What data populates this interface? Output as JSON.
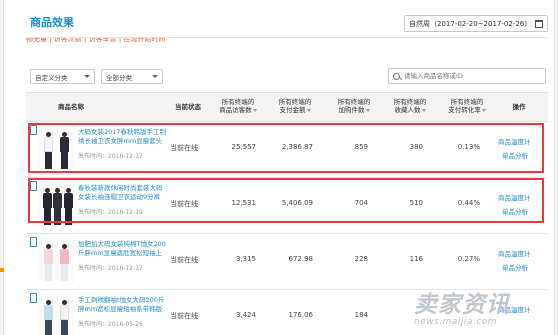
{
  "page": {
    "title": "商品效果"
  },
  "date_picker": {
    "label": "自然周（2017-02-20~2017-02-26）"
  },
  "tabs_partial": "畅无量 | 访客次数 | 访客率暂 | 挂现开始时间",
  "filters": {
    "custom_category": "自定义分类",
    "all_category": "全部分类"
  },
  "search": {
    "placeholder": "请输入商品名称或ID"
  },
  "table": {
    "headers": {
      "name": "商品名称",
      "status": "当前状态",
      "visitors": [
        "所有终端的",
        "商品访客数"
      ],
      "pay_amount": [
        "所有终端的",
        "支付金额"
      ],
      "cart_qty": [
        "所有终端的",
        "加购件数"
      ],
      "fav_count": [
        "所有终端的",
        "收藏人数"
      ],
      "conv_rate": [
        "所有终端的",
        "支付转化率"
      ],
      "action": "操作"
    },
    "rows": [
      {
        "name": "大码女装2017春秋韩版手工制绣长袖卫衣女胖mm显瘦套头打",
        "publish_time": "发布时间：2016-12-17",
        "status": "当前在线",
        "visitors": "25,557",
        "pay_amount": "2,386.87",
        "cart_qty": "859",
        "fav_count": "380",
        "conv_rate": "0.13%",
        "action_detail": "商品温度计",
        "action_analysis": "单品分析"
      },
      {
        "name": "春秋装新款休闲时尚套装大码女装长袖连帽卫衣运动9分裤",
        "publish_time": "发布时间：2016-12-19",
        "status": "当前在线",
        "visitors": "12,531",
        "pay_amount": "5,406.09",
        "cart_qty": "704",
        "fav_count": "510",
        "conv_rate": "0.44%",
        "action_detail": "商品温度计",
        "action_analysis": "单品分析"
      },
      {
        "name": "加肥加大码女装纯棉T恤女200斤胖mm显瘦遮肚宽松短袖上衣",
        "publish_time": "发布时间：2016-12-17",
        "status": "当前在线",
        "visitors": "3,315",
        "pay_amount": "672.98",
        "cart_qty": "228",
        "fav_count": "116",
        "conv_rate": "0.27%",
        "action_detail": "商品温度计",
        "action_analysis": "单品分析"
      },
      {
        "name": "手工刺绣翻袖t恤女大码200斤胖mm宽松显瘦短袖系带韩版",
        "publish_time": "发布时间：2016-05-26",
        "status": "当前在线",
        "visitors": "3,424",
        "pay_amount": "176.06",
        "cart_qty": "184",
        "fav_count": "",
        "conv_rate": "",
        "action_detail": "商品温度计",
        "action_analysis": ""
      }
    ]
  },
  "watermark": {
    "cn": "卖家资讯",
    "en": "news.maijia.com"
  },
  "colors": {
    "accent": "#1e8ec8",
    "highlight": "#e8393f",
    "header_bg": "#f3f3f3"
  }
}
